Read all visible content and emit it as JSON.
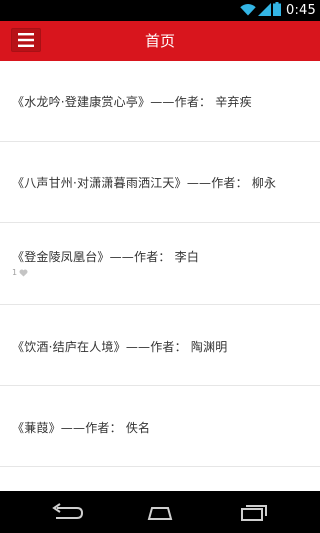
{
  "status_bar": {
    "time": "0:45",
    "icons": [
      "wifi-icon",
      "signal-icon",
      "battery-icon"
    ]
  },
  "action_bar": {
    "title": "首页",
    "menu_icon": "hamburger-menu-icon",
    "background_color": "#d8151d"
  },
  "list": {
    "items": [
      {
        "text": "《水龙吟·登建康赏心亭》——作者： 辛弃疾"
      },
      {
        "text": "《八声甘州·对潇潇暮雨洒江天》——作者： 柳永"
      },
      {
        "text": "《登金陵凤凰台》——作者： 李白",
        "likes": "1",
        "like_icon": "heart-icon"
      },
      {
        "text": "《饮酒·结庐在人境》——作者： 陶渊明"
      },
      {
        "text": "《蒹葭》——作者： 佚名"
      }
    ]
  },
  "nav_bar": {
    "buttons": [
      "back-icon",
      "home-icon",
      "recent-apps-icon"
    ]
  }
}
